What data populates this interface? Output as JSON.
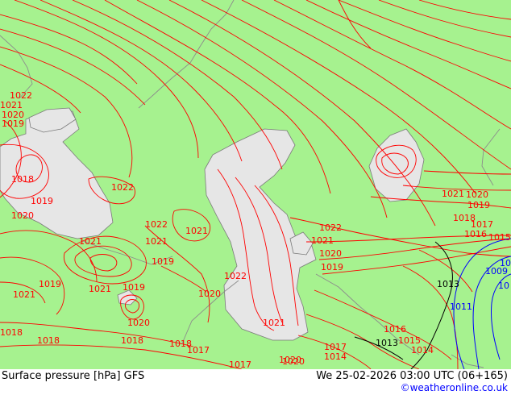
{
  "footer": {
    "left": "Surface pressure [hPa] GFS",
    "right": "We 25-02-2026 03:00 UTC (06+165)",
    "credit": "©weatheronline.co.uk"
  },
  "colors": {
    "land": "#a6f28f",
    "water": "#e6e6e6",
    "isobar_high": "#ff0000",
    "isobar_ref": "#000000",
    "isobar_low": "#0000ff",
    "border": "#8c8c8c"
  },
  "isobar_labels": [
    {
      "text": "1022",
      "kind": "high"
    },
    {
      "text": "1021",
      "kind": "high"
    },
    {
      "text": "1020",
      "kind": "high"
    },
    {
      "text": "1019",
      "kind": "high"
    },
    {
      "text": "1018",
      "kind": "high"
    },
    {
      "text": "1019",
      "kind": "high"
    },
    {
      "text": "1020",
      "kind": "high"
    },
    {
      "text": "1022",
      "kind": "high"
    },
    {
      "text": "1022",
      "kind": "high"
    },
    {
      "text": "1021",
      "kind": "high"
    },
    {
      "text": "1021",
      "kind": "high"
    },
    {
      "text": "1021",
      "kind": "high"
    },
    {
      "text": "1019",
      "kind": "high"
    },
    {
      "text": "1019",
      "kind": "high"
    },
    {
      "text": "1021",
      "kind": "high"
    },
    {
      "text": "1021",
      "kind": "high"
    },
    {
      "text": "1019",
      "kind": "high"
    },
    {
      "text": "1020",
      "kind": "high"
    },
    {
      "text": "1018",
      "kind": "high"
    },
    {
      "text": "1018",
      "kind": "high"
    },
    {
      "text": "1018",
      "kind": "high"
    },
    {
      "text": "1018",
      "kind": "high"
    },
    {
      "text": "1017",
      "kind": "high"
    },
    {
      "text": "1017",
      "kind": "high"
    },
    {
      "text": "1020",
      "kind": "high"
    },
    {
      "text": "1022",
      "kind": "high"
    },
    {
      "text": "1021",
      "kind": "high"
    },
    {
      "text": "1020",
      "kind": "high"
    },
    {
      "text": "1022",
      "kind": "high"
    },
    {
      "text": "1021",
      "kind": "high"
    },
    {
      "text": "1020",
      "kind": "high"
    },
    {
      "text": "1019",
      "kind": "high"
    },
    {
      "text": "1021",
      "kind": "high"
    },
    {
      "text": "1020",
      "kind": "high"
    },
    {
      "text": "1019",
      "kind": "high"
    },
    {
      "text": "1018",
      "kind": "high"
    },
    {
      "text": "1017",
      "kind": "high"
    },
    {
      "text": "1016",
      "kind": "high"
    },
    {
      "text": "1015",
      "kind": "high"
    },
    {
      "text": "1016",
      "kind": "high"
    },
    {
      "text": "1015",
      "kind": "high"
    },
    {
      "text": "1014",
      "kind": "high"
    },
    {
      "text": "1017",
      "kind": "high"
    },
    {
      "text": "1014",
      "kind": "high"
    },
    {
      "text": "1020",
      "kind": "high"
    },
    {
      "text": "1013",
      "kind": "ref"
    },
    {
      "text": "1013",
      "kind": "ref"
    },
    {
      "text": "1011",
      "kind": "low"
    },
    {
      "text": "1009",
      "kind": "low"
    },
    {
      "text": "10",
      "kind": "low"
    },
    {
      "text": "10",
      "kind": "low"
    }
  ]
}
